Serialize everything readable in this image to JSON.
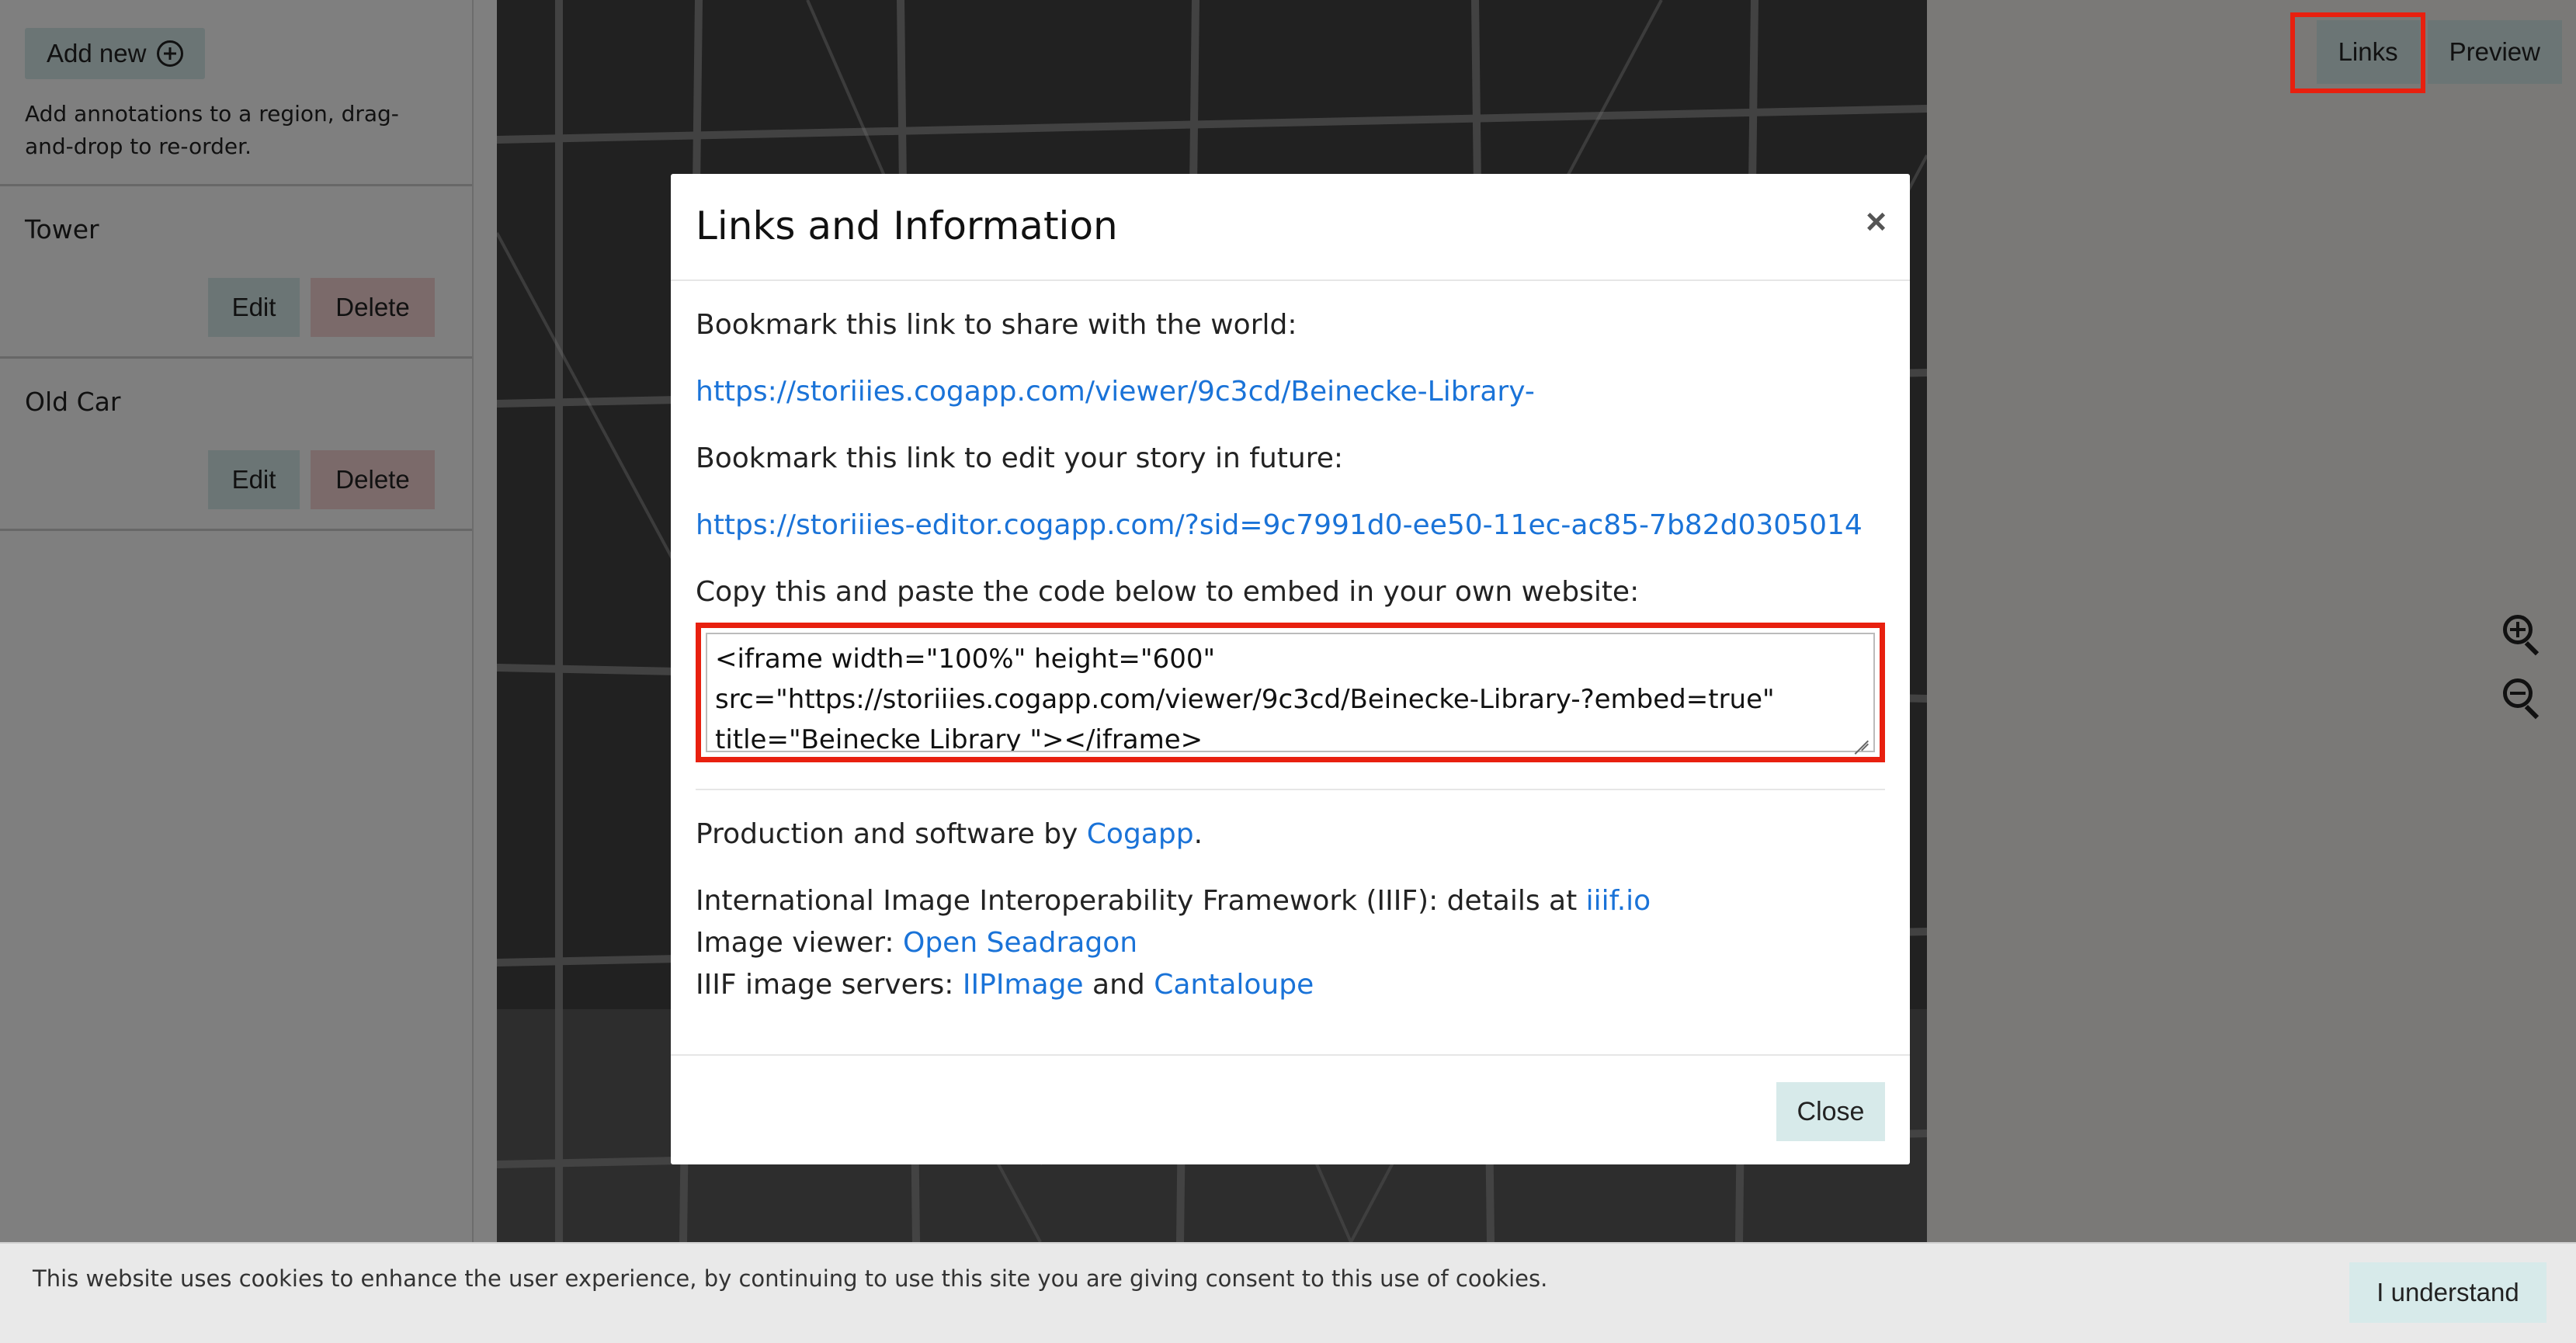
{
  "sidebar": {
    "add_new_label": "Add new",
    "hint": "Add annotations to a region, drag-and-drop to re-order.",
    "annotations": [
      {
        "title": "Tower",
        "edit_label": "Edit",
        "delete_label": "Delete"
      },
      {
        "title": "Old Car",
        "edit_label": "Edit",
        "delete_label": "Delete"
      }
    ]
  },
  "toolbar": {
    "links_label": "Links",
    "preview_label": "Preview"
  },
  "zoom": {
    "in_icon": "zoom-in-icon",
    "out_icon": "zoom-out-icon"
  },
  "modal": {
    "title": "Links and Information",
    "close_x": "×",
    "share_text": "Bookmark this link to share with the world:",
    "share_url": "https://storiiies.cogapp.com/viewer/9c3cd/Beinecke-Library-",
    "edit_text": "Bookmark this link to edit your story in future:",
    "edit_url": "https://storiiies-editor.cogapp.com/?sid=9c7991d0-ee50-11ec-ac85-7b82d0305014",
    "embed_text": "Copy this and paste the code below to embed in your own website:",
    "embed_code": "<iframe width=\"100%\" height=\"600\" src=\"https://storiiies.cogapp.com/viewer/9c3cd/Beinecke-Library-?embed=true\" title=\"Beinecke Library \"></iframe>",
    "production_prefix": "Production and software by ",
    "production_link": "Cogapp",
    "production_suffix": ".",
    "iiif_prefix": "International Image Interoperability Framework (IIIF): details at ",
    "iiif_link": "iiif.io",
    "viewer_prefix": "Image viewer: ",
    "viewer_link": "Open Seadragon",
    "servers_prefix": "IIIF image servers: ",
    "servers_link1": "IIPImage",
    "servers_and": " and ",
    "servers_link2": "Cantaloupe",
    "close_label": "Close"
  },
  "cookie": {
    "text": "This website uses cookies to enhance the user experience, by continuing to use this site you are giving consent to this use of cookies.",
    "button_label": "I understand"
  },
  "colors": {
    "accent_button": "#d7eaea",
    "delete_button": "#f6d5d5",
    "link": "#1a73d8",
    "highlight": "#e8200f"
  }
}
